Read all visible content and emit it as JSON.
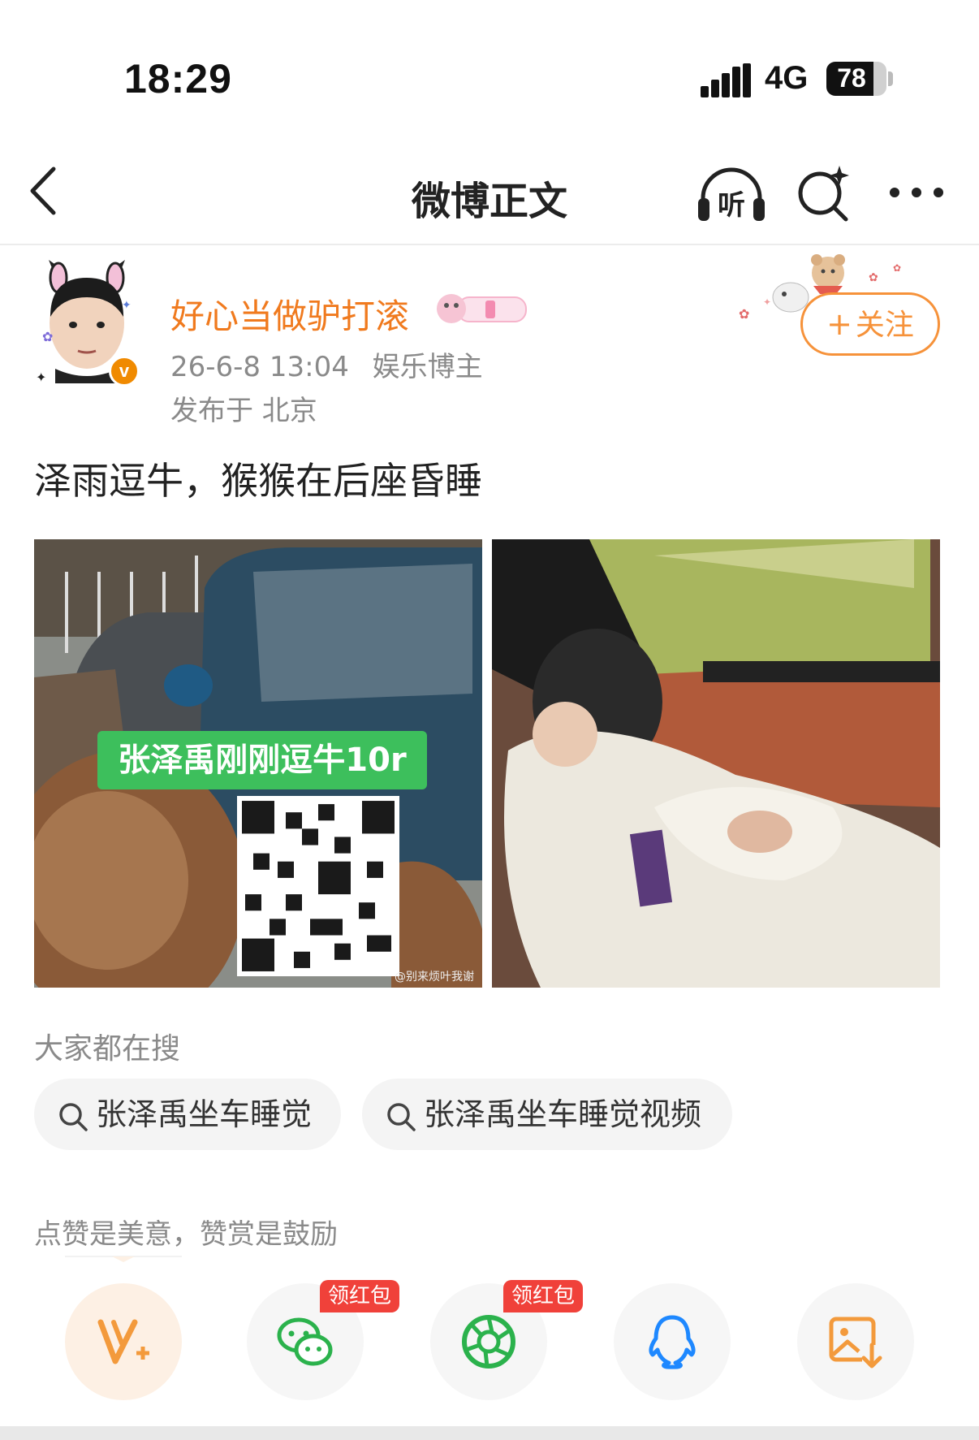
{
  "status_bar": {
    "time": "18:29",
    "network": "4G",
    "battery": "78",
    "battery_level": 0.78
  },
  "nav": {
    "title": "微博正文",
    "listen_label": "听"
  },
  "post": {
    "username": "好心当做驴打滚",
    "date": "26-6-8 13:04",
    "author_tag": "娱乐博主",
    "location": "发布于 北京",
    "follow_label": "关注",
    "text": "泽雨逗牛，猴猴在后座昏睡",
    "verified_mark": "v",
    "images": [
      {
        "overlay_text": "张泽禹刚刚逗牛10r",
        "watermark": "@别来烦叶我谢"
      },
      {
        "overlay_text": ""
      }
    ]
  },
  "everyone_searching": {
    "label": "大家都在搜",
    "chips": [
      "张泽禹坐车睡觉",
      "张泽禹坐车睡觉视频"
    ]
  },
  "reward": {
    "label": "点赞是美意，赞赏是鼓励",
    "red_packet_tag": "领红包",
    "buttons": [
      "reward-v-icon",
      "wechat-icon",
      "moments-icon",
      "qq-icon",
      "save-image-icon"
    ]
  },
  "colors": {
    "accent": "#f6923a",
    "username": "#f07a1e",
    "meta": "#8a8a8a",
    "green_label": "#3dbf5c",
    "red_tag": "#f0413a",
    "wechat": "#2bb24c",
    "qq": "#1e88ff"
  }
}
